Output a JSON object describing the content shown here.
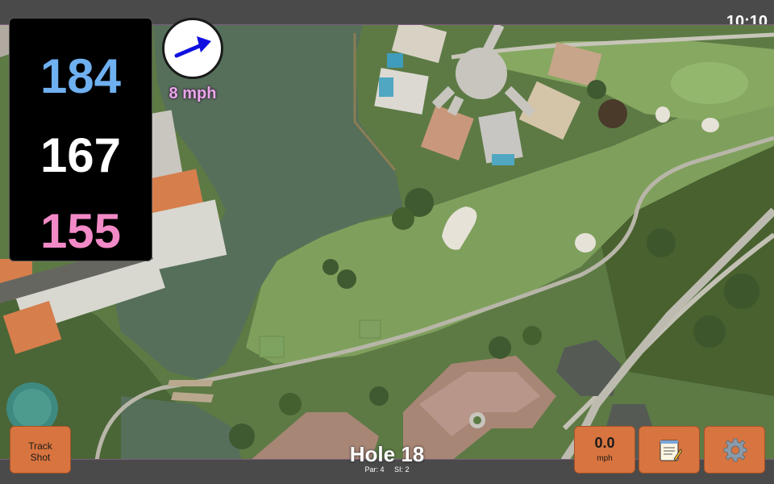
{
  "status_bar": {
    "time": "10:10"
  },
  "distances": {
    "back": "184",
    "middle": "167",
    "front": "155"
  },
  "wind": {
    "speed": "8 mph",
    "direction_icon": "arrow-up-right-icon"
  },
  "hole": {
    "title": "Hole 18",
    "par": "Par: 4",
    "stroke_index": "SI: 2"
  },
  "buttons": {
    "track_shot_line1": "Track",
    "track_shot_line2": "Shot",
    "wind_value": "0.0",
    "wind_unit": "mph",
    "notes_icon": "notepad-icon",
    "settings_icon": "gear-icon"
  },
  "colors": {
    "back_distance": "#6fb0f0",
    "middle_distance": "#ffffff",
    "front_distance": "#f38ac8",
    "button": "#d8743f",
    "wind_arrow": "#1010e0",
    "wind_text": "#e8a8ea"
  }
}
